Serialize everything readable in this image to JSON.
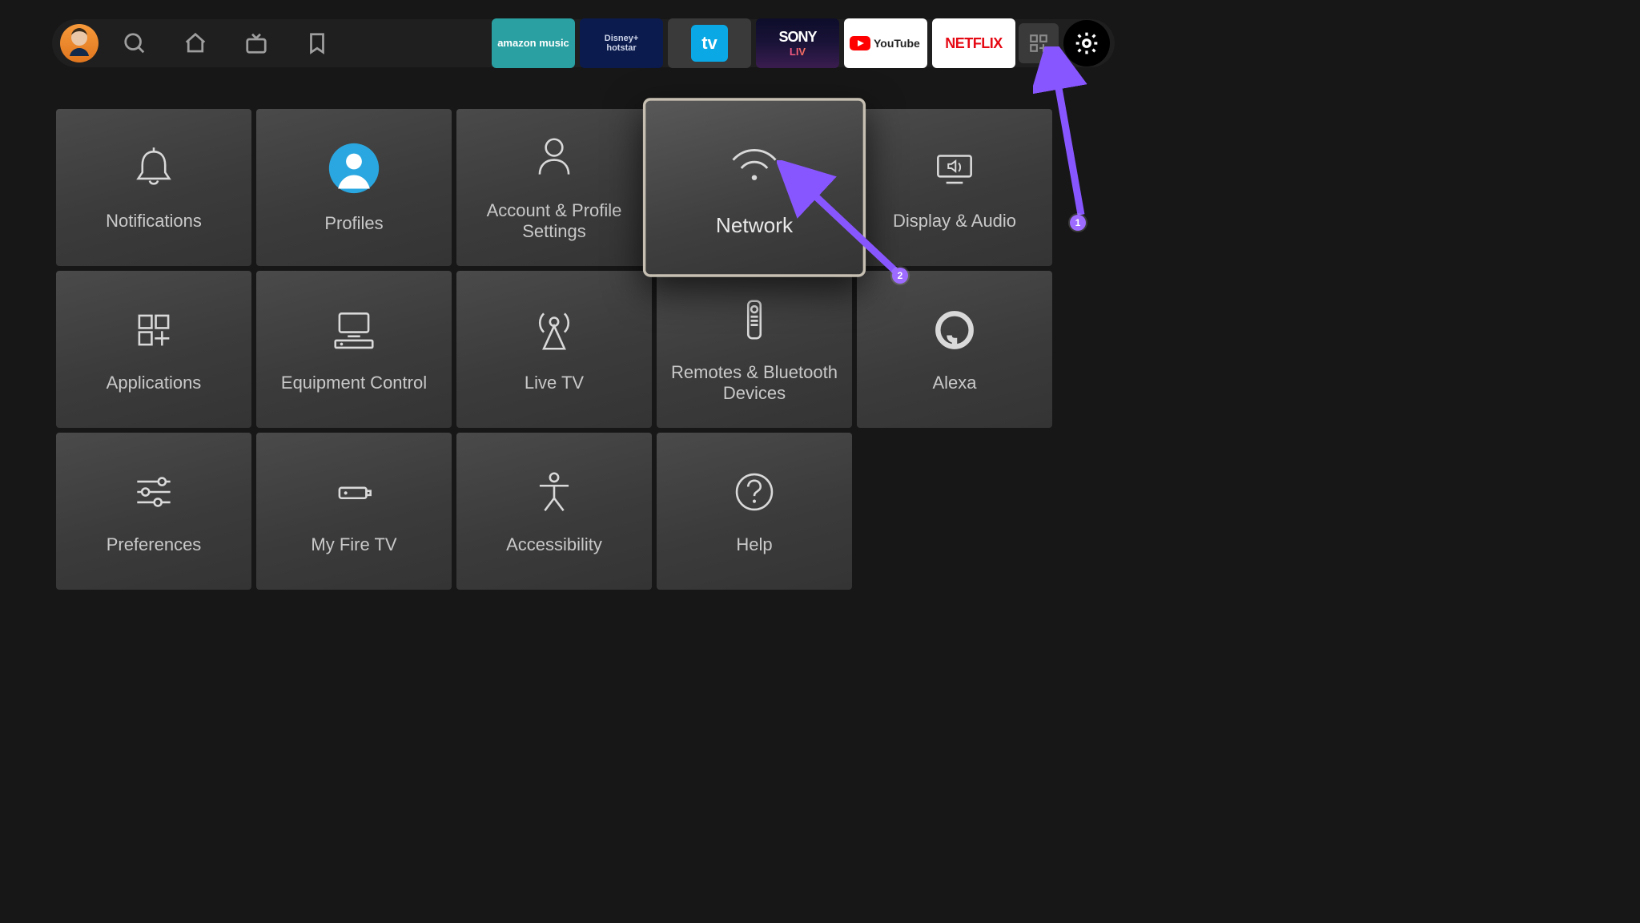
{
  "topbar": {
    "apps": {
      "amazon_music": "amazon music",
      "hotstar_top": "Disney+",
      "hotstar_bottom": "hotstar",
      "tv": "tv",
      "sony_top": "SONY",
      "sony_bottom": "LIV",
      "youtube": "YouTube",
      "netflix": "NETFLIX"
    }
  },
  "settings": {
    "tiles": [
      {
        "id": "notifications",
        "label": "Notifications"
      },
      {
        "id": "profiles",
        "label": "Profiles"
      },
      {
        "id": "account",
        "label": "Account & Profile Settings"
      },
      {
        "id": "network",
        "label": "Network"
      },
      {
        "id": "display",
        "label": "Display & Audio"
      },
      {
        "id": "applications",
        "label": "Applications"
      },
      {
        "id": "equipment",
        "label": "Equipment Control"
      },
      {
        "id": "livetv",
        "label": "Live TV"
      },
      {
        "id": "remotes",
        "label": "Remotes & Bluetooth Devices"
      },
      {
        "id": "alexa",
        "label": "Alexa"
      },
      {
        "id": "preferences",
        "label": "Preferences"
      },
      {
        "id": "myfiretv",
        "label": "My Fire TV"
      },
      {
        "id": "accessibility",
        "label": "Accessibility"
      },
      {
        "id": "help",
        "label": "Help"
      }
    ],
    "selected": "network"
  },
  "annotations": {
    "badge1": "1",
    "badge2": "2"
  }
}
